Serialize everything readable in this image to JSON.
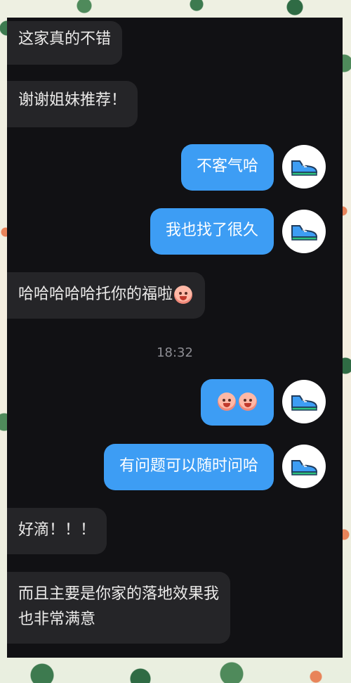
{
  "messages": [
    {
      "side": "left",
      "text": "这家真的不错"
    },
    {
      "side": "left",
      "text": "谢谢姐妹推荐！"
    },
    {
      "side": "right",
      "text": "不客气哈"
    },
    {
      "side": "right",
      "text": "我也找了很久"
    },
    {
      "side": "left",
      "text": "哈哈哈哈哈托你的福啦",
      "emoji": "laughing-face-emoji"
    },
    {
      "side": "right",
      "text": "",
      "emoji": "blushing-face-emoji x2"
    },
    {
      "side": "right",
      "text": "有问题可以随时问哈"
    },
    {
      "side": "left",
      "text": "好滴！！！"
    },
    {
      "side": "left",
      "text_line1": "而且主要是你家的落地效果我",
      "text_line2": "也非常满意"
    }
  ],
  "timestamp": "18:32",
  "avatar_icon": "sneaker-icon",
  "colors": {
    "panel_bg": "#111114",
    "left_bubble": "#252528",
    "right_bubble": "#3d9df4",
    "timestamp_text": "#8d8d93"
  }
}
